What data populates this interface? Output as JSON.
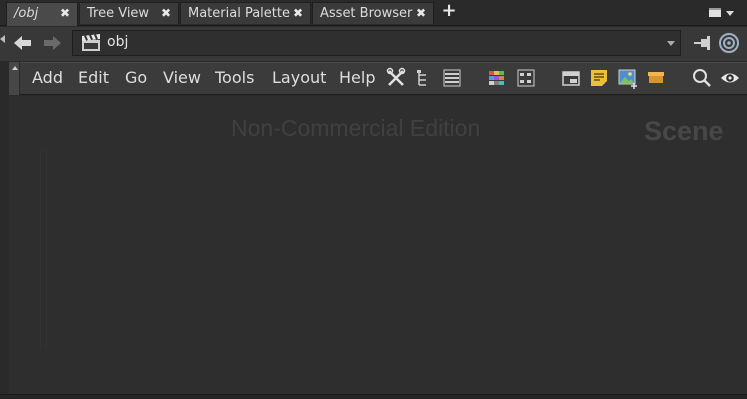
{
  "tabs": [
    {
      "label": "/obj",
      "active": true
    },
    {
      "label": "Tree View",
      "active": false
    },
    {
      "label": "Material Palette",
      "active": false
    },
    {
      "label": "Asset Browser",
      "active": false
    }
  ],
  "tab_close_glyph": "✖",
  "tab_add_glyph": "+",
  "path": {
    "value": "obj",
    "icon": "obj-network-icon"
  },
  "menu": [
    "Add",
    "Edit",
    "Go",
    "View",
    "Tools",
    "Layout",
    "Help"
  ],
  "toolbar_icons": [
    "tools-icon",
    "tree-layout-icon",
    "list-view-icon",
    "color-palette-icon",
    "shape-palette-icon",
    "network-box-icon",
    "sticky-note-icon",
    "background-image-icon",
    "dashboard-icon",
    "search-icon",
    "display-eye-icon"
  ],
  "canvas": {
    "watermark": "Non-Commercial Edition",
    "context_label": "Scene"
  },
  "colors": {
    "background": "#2e2e2e",
    "toolbar": "#3b3b3b",
    "active_tab": "#4a4a4a",
    "sticky_note": "#e9c23a"
  }
}
